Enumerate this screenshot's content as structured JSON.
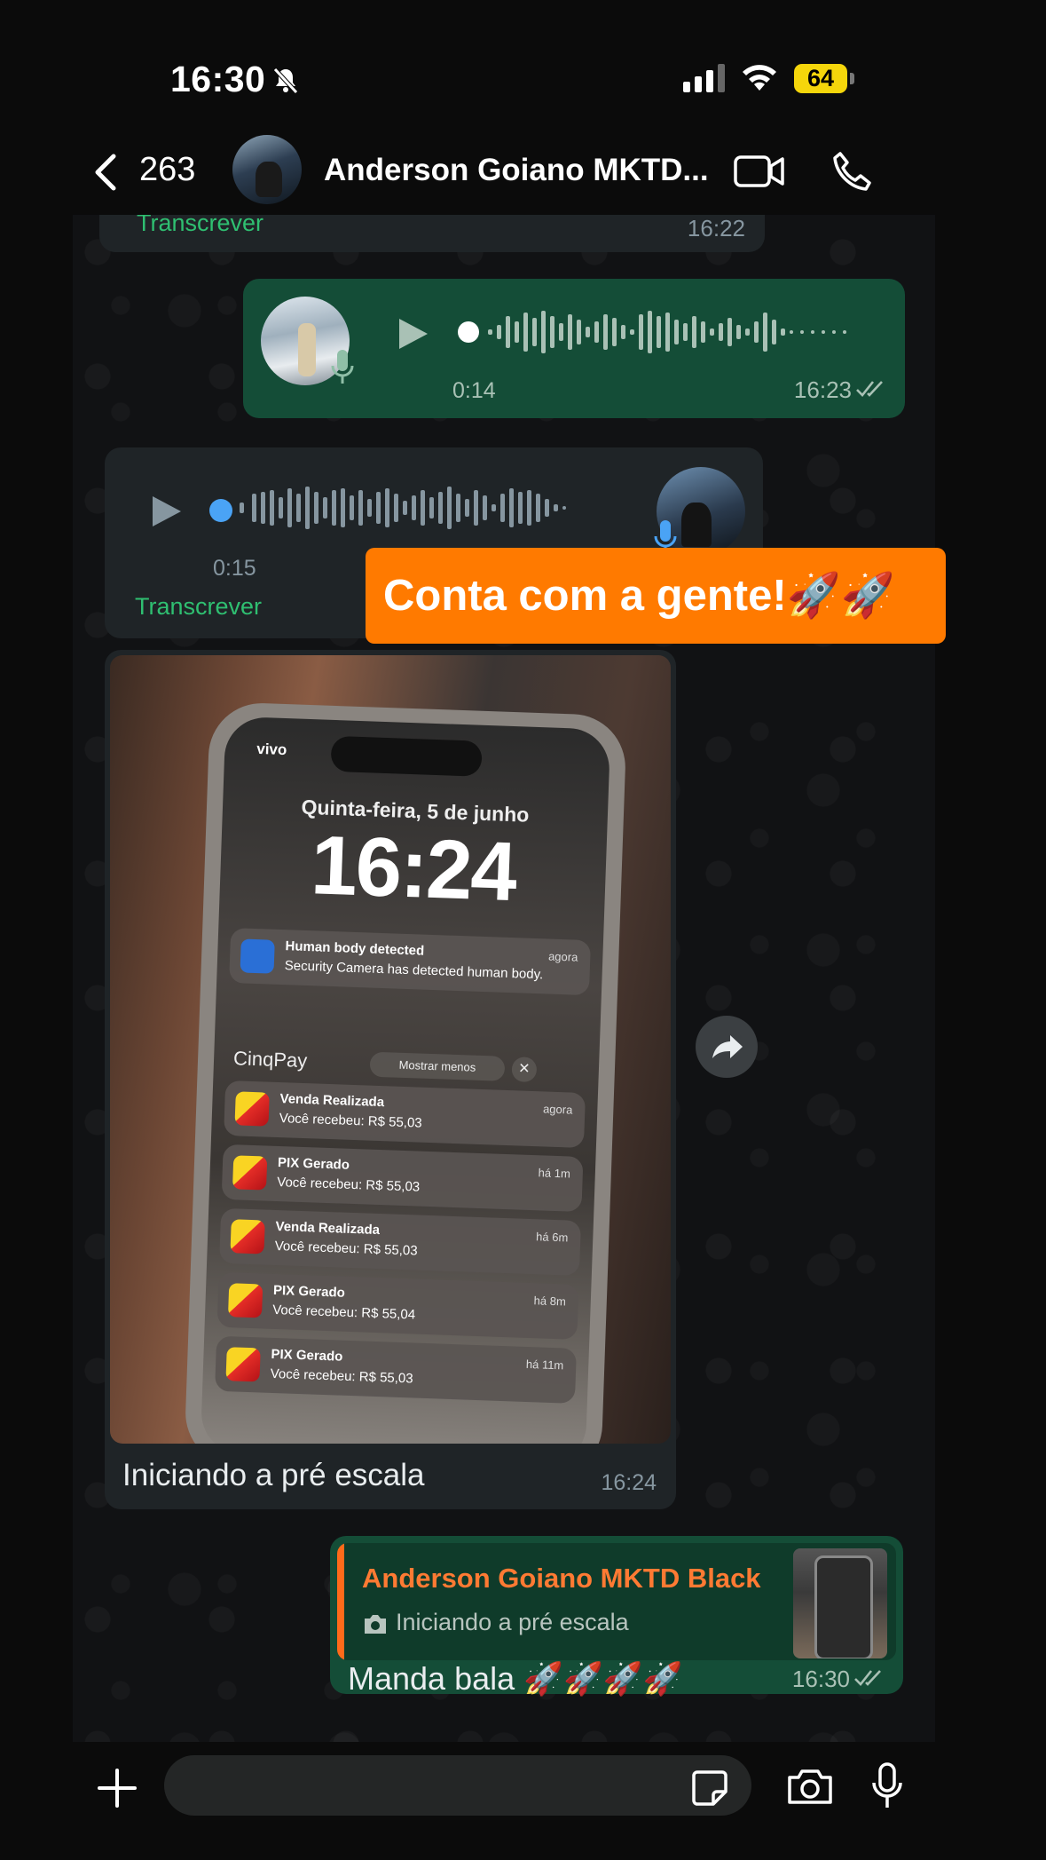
{
  "status": {
    "time": "16:30",
    "battery": "64"
  },
  "header": {
    "unread": "263",
    "contact_name": "Anderson Goiano MKTD..."
  },
  "messages": {
    "prev_incoming": {
      "transcribe": "Transcrever",
      "time": "16:22"
    },
    "voice_out": {
      "duration": "0:14",
      "time": "16:23"
    },
    "voice_in": {
      "duration": "0:15",
      "transcribe": "Transcrever"
    },
    "sticker": {
      "text": "Conta com a gente!🚀🚀"
    },
    "image_in": {
      "caption": "Iniciando a pré escala",
      "time": "16:24",
      "screen": {
        "carrier": "vivo",
        "date": "Quinta-feira, 5 de junho",
        "clock": "16:24",
        "security_title": "Human body detected",
        "security_body": "Security Camera has detected human body.",
        "security_time": "agora",
        "app_name": "CinqPay",
        "show_less": "Mostrar menos",
        "notifications": [
          {
            "title": "Venda Realizada",
            "body": "Você recebeu: R$ 55,03",
            "time": "agora"
          },
          {
            "title": "PIX Gerado",
            "body": "Você recebeu: R$ 55,03",
            "time": "há 1m"
          },
          {
            "title": "Venda Realizada",
            "body": "Você recebeu: R$ 55,03",
            "time": "há 6m"
          },
          {
            "title": "PIX Gerado",
            "body": "Você recebeu: R$ 55,04",
            "time": "há 8m"
          },
          {
            "title": "PIX Gerado",
            "body": "Você recebeu: R$ 55,03",
            "time": "há 11m"
          }
        ]
      }
    },
    "reply_out": {
      "quoted_name": "Anderson Goiano MKTD Black",
      "quoted_text": "Iniciando a pré escala",
      "text": "Manda bala 🚀🚀🚀🚀",
      "time": "16:30"
    }
  },
  "input": {
    "placeholder": ""
  },
  "colors": {
    "outgoing_bubble": "#144d37",
    "incoming_bubble": "#1f2427",
    "accent_green": "#2fbf71",
    "sticker_orange": "#ff7a00",
    "quote_name": "#ff7a33"
  }
}
